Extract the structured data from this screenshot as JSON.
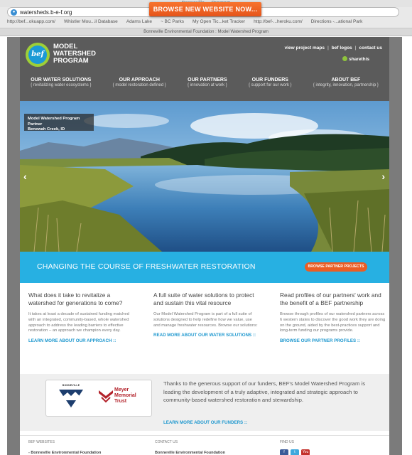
{
  "browser": {
    "window_title": "Bonneville ... Program",
    "url": "watersheds.b-e-f.org",
    "bookmarks": [
      "http://bef...okuapp.com/",
      "Whistler Mou...il Database",
      "Adams Lake",
      "~ BC Parks",
      "My Open Tic...ket Tracker",
      "http://bef-...heroku.com/",
      "Directions -...ational Park"
    ],
    "tab_title": "Bonneville Environmental Foundation : Model Watershed Program",
    "promo_label": "BROWSE NEW WEBSITE NOW..."
  },
  "header": {
    "logo_mark": "bef",
    "logo_lines": [
      "MODEL",
      "WATERSHED",
      "PROGRAM"
    ],
    "util_links": [
      "view project maps",
      "bef logos",
      "contact us"
    ],
    "util_separator": "|",
    "share_label": "sharethis",
    "nav": [
      {
        "main": "OUR WATER SOLUTIONS",
        "sub": "{ revitalizing water ecosystems }"
      },
      {
        "main": "OUR APPROACH",
        "sub": "{ model restoration defined }"
      },
      {
        "main": "OUR PARTNERS",
        "sub": "{ innovation at work }"
      },
      {
        "main": "OUR FUNDERS",
        "sub": "{ support for our work }"
      },
      {
        "main": "ABOUT BEF",
        "sub": "{ integrity, innovation, partnership }"
      }
    ]
  },
  "hero": {
    "caption_line1": "Model Watershed Program Partner",
    "caption_line2": "Benewah Creek, ID",
    "prev_arrow": "‹",
    "next_arrow": "›"
  },
  "banner": {
    "title": "CHANGING THE COURSE OF FRESHWATER RESTORATION",
    "button": "BROWSE PARTNER PROJECTS"
  },
  "columns": [
    {
      "heading": "What does it take to revitalize a watershed for generations to come?",
      "body": "It takes at least a decade of sustained funding matched with an integrated, community-based, whole watershed approach to address the leading barriers to effective restoration – an approach we champion every day.",
      "link": "LEARN MORE ABOUT OUR APPROACH ::"
    },
    {
      "heading": "A full suite of water solutions to protect and sustain this vital resource",
      "body": "Our Model Watershed Program is part of a full suite of solutions designed to help redefine how we value, use and manage freshwater resources. Browse our solutions:",
      "link": "READ MORE ABOUT OUR WATER SOLUTIONS ::"
    },
    {
      "heading": "Read profiles of our partners' work and the benefit of a BEF partnership",
      "body": "Browse through profiles of our watershed partners across 6 western states to discover the good work they are doing on the ground, aided by the best-practices support and long-term funding our programs provide.",
      "link": "BROWSE OUR PARTNER PROFILES ::"
    }
  ],
  "funders": {
    "bonneville_logo_text": "BONNEVILLE",
    "meyer_logo_lines": [
      "Meyer",
      "Memorial",
      "Trust"
    ],
    "text": "Thanks to the generous support of our funders, BEF's Model Watershed Program is leading the development of a truly adaptive, integrated and strategic approach to community-based watershed restoration and stewardship.",
    "link": "LEARN MORE ABOUT OUR FUNDERS ::"
  },
  "footer": {
    "col1_title": "BEF WEBSITES",
    "col1_item": "- Bonneville Environmental Foundation",
    "col2_title": "CONTACT US",
    "col2_item": "Bonneville Environmental Foundation",
    "col3_title": "FIND US",
    "icons": [
      "f",
      "t",
      "You"
    ]
  },
  "colors": {
    "header_bg": "#5b5b5b",
    "banner_blue": "#27b0e2",
    "accent_orange": "#ea5d24",
    "link_blue": "#1f98cf",
    "logo_green": "#9ecf37",
    "logo_blue": "#1c9ad6"
  }
}
